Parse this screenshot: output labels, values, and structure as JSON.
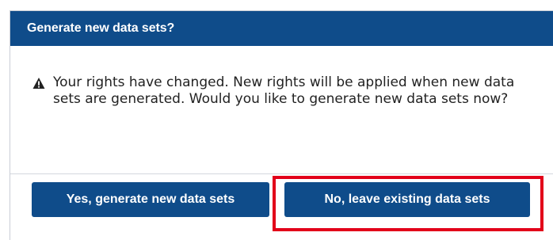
{
  "dialog": {
    "title": "Generate new data sets?",
    "message": "Your rights have changed. New rights will be applied when new data sets are generated. Would you like to generate new data sets now?",
    "icon": "warning-icon",
    "buttons": {
      "yes_label": "Yes, generate new data sets",
      "no_label": "No, leave existing data sets"
    }
  },
  "colors": {
    "header": "#0f4c8a",
    "button": "#0f4c8a",
    "highlight": "#e2001a"
  }
}
